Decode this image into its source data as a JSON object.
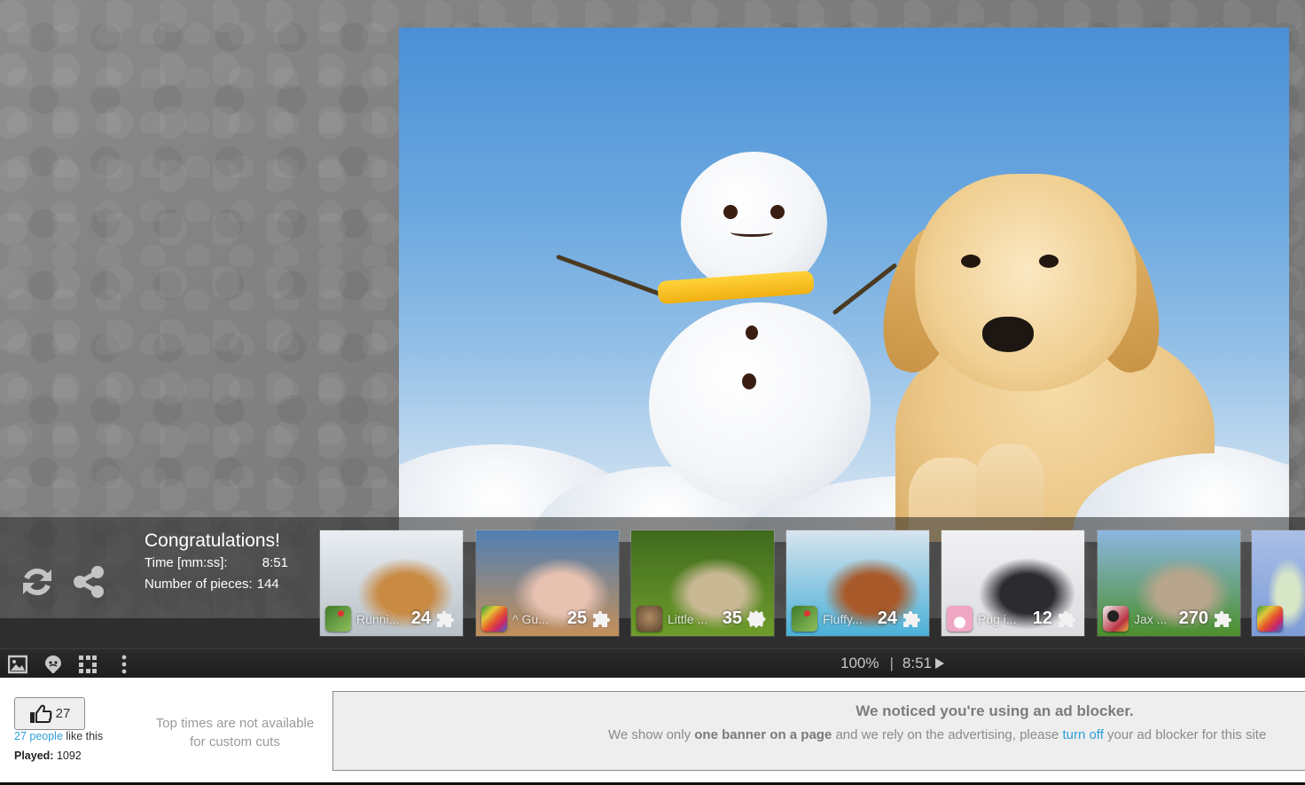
{
  "puzzle": {
    "image_subject": "snowman-and-golden-retriever-puppy",
    "zoom_level": "100%",
    "elapsed_time": "8:51",
    "play_icon": "play-icon"
  },
  "finish": {
    "actions": [
      {
        "name": "restart",
        "icon": "refresh-icon"
      },
      {
        "name": "share",
        "icon": "share-icon"
      }
    ],
    "title": "Congratulations!",
    "time_label": "Time [mm:ss]:",
    "time_value": "8:51",
    "pieces_label": "Number of pieces:",
    "pieces_value": "144"
  },
  "suggestions": [
    {
      "caption": "Runni...",
      "count": "24",
      "cut": "classic",
      "author_icon": "bird-avatar",
      "colors": [
        "#e9eef2",
        "#b8c1c8",
        "#c98a43"
      ]
    },
    {
      "caption": "^ Gu...",
      "count": "25",
      "cut": "classic",
      "author_icon": "rainbow-avatar",
      "colors": [
        "#4f7fb4",
        "#c4905a",
        "#e8c2b1"
      ]
    },
    {
      "caption": "Little ...",
      "count": "35",
      "cut": "leather",
      "author_icon": "cat-avatar",
      "colors": [
        "#3f6a1e",
        "#6e9c2b",
        "#c9b894"
      ]
    },
    {
      "caption": "Fluffy...",
      "count": "24",
      "cut": "classic",
      "author_icon": "bird-avatar",
      "colors": [
        "#d7e4ef",
        "#4ab0d6",
        "#a85a2b"
      ]
    },
    {
      "caption": "Pug i...",
      "count": "12",
      "cut": "classic",
      "author_icon": "hamster-avatar",
      "colors": [
        "#f1f1f3",
        "#dcdde0",
        "#2c2c30"
      ]
    },
    {
      "caption": "Jax ...",
      "count": "270",
      "cut": "classic",
      "author_icon": "dog-avatar",
      "colors": [
        "#8cb6e2",
        "#4c8f2c",
        "#b8a68c"
      ]
    },
    {
      "caption": "",
      "count": "",
      "cut": "",
      "author_icon": "rainbow-avatar",
      "colors": [
        "#a9bfe6",
        "#7d9bd8",
        "#d8e6c8"
      ]
    }
  ],
  "toolbar": {
    "icons": [
      "image-icon",
      "ghost-icon",
      "grid-icon",
      "more-vertical-icon"
    ],
    "zoom": "100%",
    "separator": "|",
    "time": "8:51"
  },
  "social": {
    "like_count": "27",
    "likes_link": "27 people",
    "likes_suffix": " like this",
    "played_label": "Played:",
    "played_value": " 1092"
  },
  "top_times": {
    "line1": "Top times are not available",
    "line2": "for custom cuts"
  },
  "adblock": {
    "title": "We noticed you're using an ad blocker.",
    "msg_part1": "We show only ",
    "msg_bold": "one banner on a page",
    "msg_part2": " and we rely on the advertising, please ",
    "msg_link": "turn off",
    "msg_part3": " your ad blocker for this site"
  }
}
